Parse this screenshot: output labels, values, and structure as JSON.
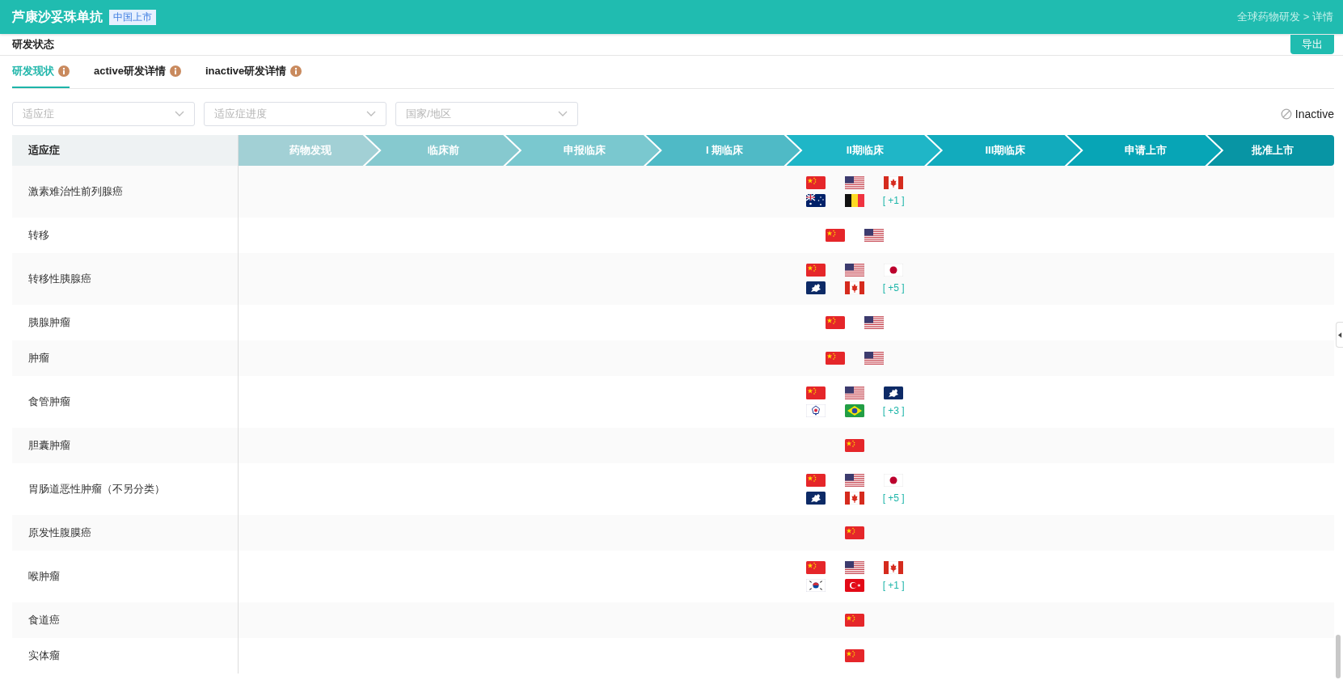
{
  "header": {
    "title": "芦康沙妥珠单抗",
    "badge": "中国上市",
    "breadcrumb": "全球药物研发 > 详情"
  },
  "section": {
    "title": "研发状态",
    "export_button": "导出"
  },
  "tabs": [
    {
      "label": "研发现状",
      "selected": true
    },
    {
      "label": "active研发详情",
      "selected": false
    },
    {
      "label": "inactive研发详情",
      "selected": false
    }
  ],
  "filters": [
    {
      "placeholder": "适应症"
    },
    {
      "placeholder": "适应症进度"
    },
    {
      "placeholder": "国家/地区"
    }
  ],
  "legend": {
    "label": "Inactive"
  },
  "table": {
    "indication_header": "适应症",
    "stages": [
      {
        "label": "药物发现",
        "color": "#a2d0d5"
      },
      {
        "label": "临床前",
        "color": "#86c9cf"
      },
      {
        "label": "申报临床",
        "color": "#7ac8cf"
      },
      {
        "label": "I 期临床",
        "color": "#4fbac6"
      },
      {
        "label": "II期临床",
        "color": "#1fb6c7"
      },
      {
        "label": "III期临床",
        "color": "#12abbd"
      },
      {
        "label": "申请上市",
        "color": "#07a5b6"
      },
      {
        "label": "批准上市",
        "color": "#0895a4"
      }
    ],
    "rows": [
      {
        "indication": "激素难治性前列腺癌",
        "kind": "phase_2",
        "flags": [
          {
            "kind": "cn"
          },
          {
            "kind": "us"
          },
          {
            "kind": "ca"
          },
          {
            "kind": "au"
          },
          {
            "kind": "be"
          }
        ],
        "more": "[ +1 ]"
      },
      {
        "indication": "转移",
        "kind": "phase_2",
        "flags": [
          {
            "kind": "cn"
          },
          {
            "kind": "us"
          }
        ]
      },
      {
        "indication": "转移性胰腺癌",
        "kind": "phase_2",
        "flags": [
          {
            "kind": "cn"
          },
          {
            "kind": "us"
          },
          {
            "kind": "jp"
          },
          {
            "kind": "eu"
          },
          {
            "kind": "ca"
          }
        ],
        "more": "[ +5 ]"
      },
      {
        "indication": "胰腺肿瘤",
        "kind": "phase_2",
        "flags": [
          {
            "kind": "cn"
          },
          {
            "kind": "us"
          }
        ]
      },
      {
        "indication": "肿瘤",
        "kind": "phase_2",
        "flags": [
          {
            "kind": "cn"
          },
          {
            "kind": "us"
          }
        ]
      },
      {
        "indication": "食管肿瘤",
        "kind": "phase_2",
        "flags": [
          {
            "kind": "cn"
          },
          {
            "kind": "us"
          },
          {
            "kind": "eu"
          },
          {
            "kind": "tw"
          },
          {
            "kind": "br"
          }
        ],
        "more": "[ +3 ]"
      },
      {
        "indication": "胆囊肿瘤",
        "kind": "phase_2",
        "flags": [
          {
            "kind": "cn"
          }
        ]
      },
      {
        "indication": "胃肠道恶性肿瘤（不另分类）",
        "kind": "phase_2",
        "flags": [
          {
            "kind": "cn"
          },
          {
            "kind": "us"
          },
          {
            "kind": "jp"
          },
          {
            "kind": "eu"
          },
          {
            "kind": "ca"
          }
        ],
        "more": "[ +5 ]"
      },
      {
        "indication": "原发性腹膜癌",
        "kind": "phase_2",
        "flags": [
          {
            "kind": "cn"
          }
        ]
      },
      {
        "indication": "喉肿瘤",
        "kind": "phase_2",
        "flags": [
          {
            "kind": "cn"
          },
          {
            "kind": "us"
          },
          {
            "kind": "ca"
          },
          {
            "kind": "kr"
          },
          {
            "kind": "tr"
          }
        ],
        "more": "[ +1 ]"
      },
      {
        "indication": "食道癌",
        "kind": "phase_2",
        "flags": [
          {
            "kind": "cn"
          }
        ]
      },
      {
        "indication": "实体瘤",
        "kind": "phase_2",
        "flags": [
          {
            "kind": "cn"
          }
        ]
      }
    ]
  }
}
